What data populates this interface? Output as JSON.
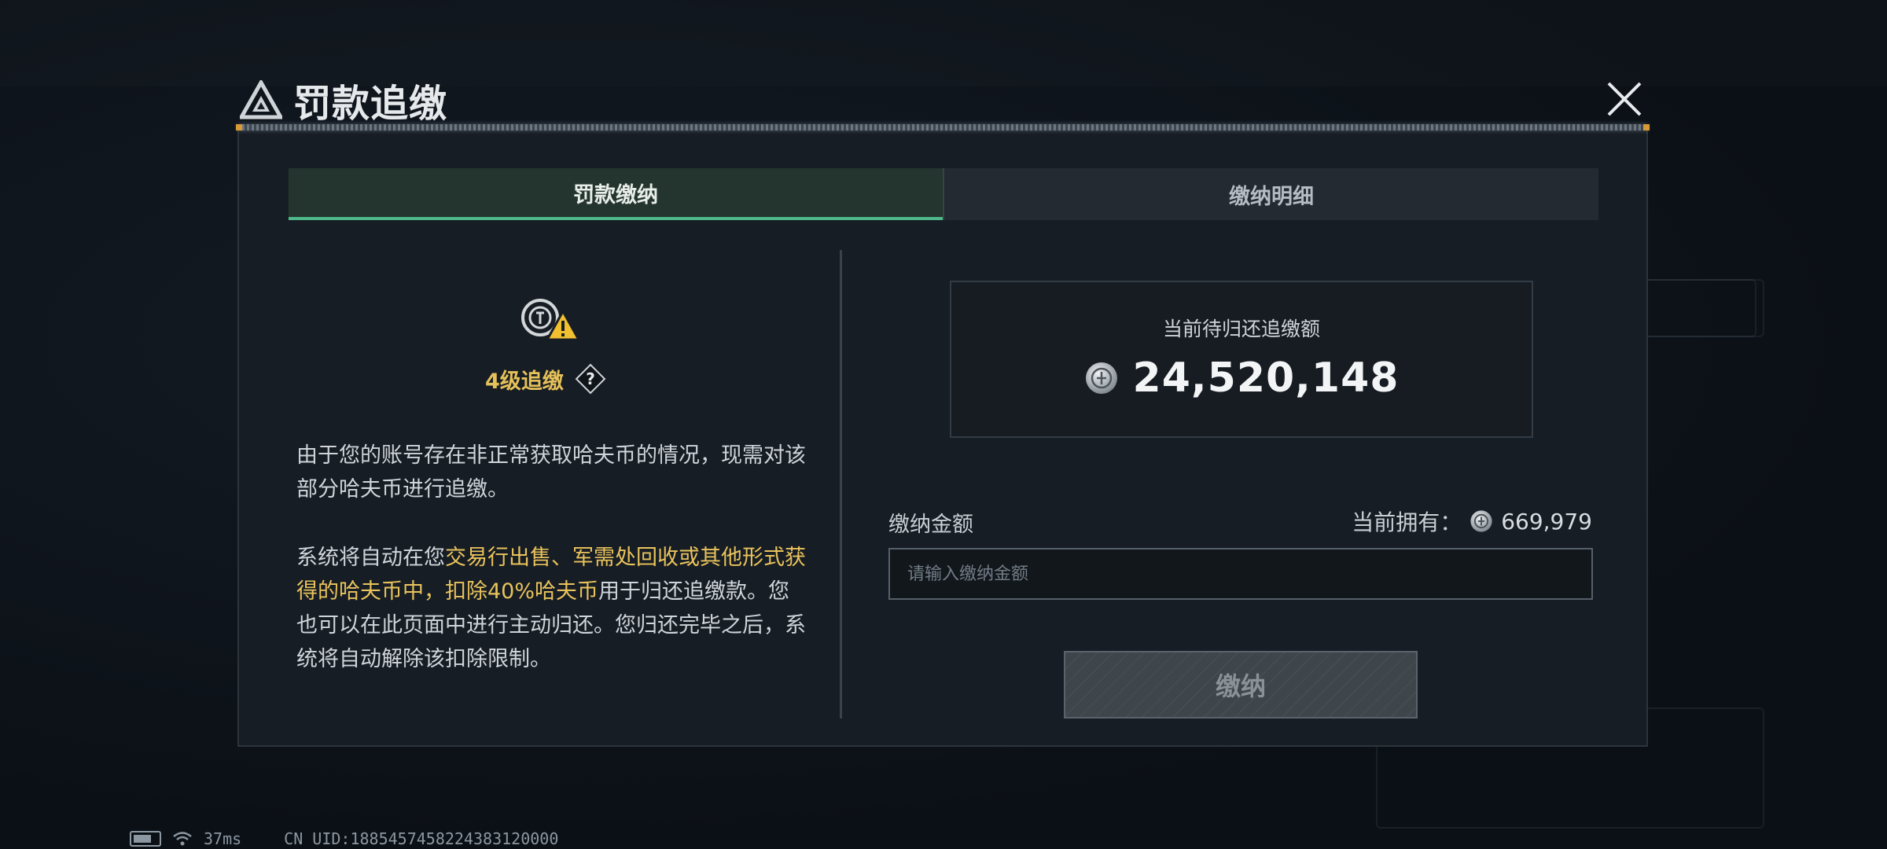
{
  "dialog": {
    "title": "罚款追缴"
  },
  "tabs": [
    {
      "label": "罚款缴纳",
      "active": true
    },
    {
      "label": "缴纳明细",
      "active": false
    }
  ],
  "left": {
    "level": "4级追缴",
    "help_icon": "question-diamond-icon",
    "para1": "由于您的账号存在非正常获取哈夫币的情况，现需对该部分哈夫币进行追缴。",
    "para2_prefix": "系统将自动在您",
    "para2_highlight1": "交易行出售、军需处回收或其他形式获得的哈夫币中，扣除40%哈夫币",
    "para2_suffix": "用于归还追缴款。您也可以在此页面中进行主动归还。您归还完毕之后，系统将自动解除该扣除限制。"
  },
  "right": {
    "debt_label": "当前待归还追缴额",
    "debt_amount": "24,520,148",
    "amount_label": "缴纳金额",
    "owned_label": "当前拥有：",
    "owned_value": "669,979",
    "input_placeholder": "请输入缴纳金额",
    "input_value": "",
    "pay_button": "缴纳"
  },
  "status_bar": {
    "ping": "37ms",
    "uid": "CN UID:1885457458224383120000"
  },
  "colors": {
    "accent_green": "#4fb88a",
    "highlight_yellow": "#e9c35c",
    "title_orange": "#d79a35"
  }
}
